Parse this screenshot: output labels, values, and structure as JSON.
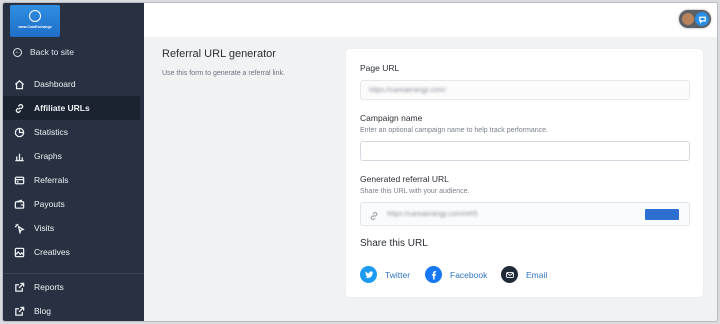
{
  "sidebar": {
    "logo_text": "www.CoinExchange",
    "back_label": "Back to site",
    "items": [
      {
        "label": "Dashboard",
        "icon": "home-icon",
        "active": false
      },
      {
        "label": "Affiliate URLs",
        "icon": "link-icon",
        "active": true
      },
      {
        "label": "Statistics",
        "icon": "pie-chart-icon",
        "active": false
      },
      {
        "label": "Graphs",
        "icon": "bar-chart-icon",
        "active": false
      },
      {
        "label": "Referrals",
        "icon": "card-icon",
        "active": false
      },
      {
        "label": "Payouts",
        "icon": "wallet-icon",
        "active": false
      },
      {
        "label": "Visits",
        "icon": "cursor-icon",
        "active": false
      },
      {
        "label": "Creatives",
        "icon": "image-icon",
        "active": false
      }
    ],
    "secondary": [
      {
        "label": "Reports",
        "icon": "external-link-icon"
      },
      {
        "label": "Blog",
        "icon": "external-link-icon"
      }
    ]
  },
  "header": {
    "toggle_icon": "chat-icon"
  },
  "intro": {
    "title": "Referral URL generator",
    "subtitle": "Use this form to generate a referral link."
  },
  "form": {
    "page_url_label": "Page URL",
    "page_url_value": "https://careaerangji.com/",
    "campaign_label": "Campaign name",
    "campaign_help": "Enter an optional campaign name to help track performance.",
    "campaign_value": "",
    "generated_label": "Generated referral URL",
    "generated_help": "Share this URL with your audience.",
    "generated_value": "https://careaerangji.com/ref/5",
    "share_title": "Share this URL",
    "share": [
      {
        "label": "Twitter",
        "icon": "twitter-icon",
        "color": "#1d9bf0"
      },
      {
        "label": "Facebook",
        "icon": "facebook-icon",
        "color": "#1877f2"
      },
      {
        "label": "Email",
        "icon": "email-icon",
        "color": "#1f2937"
      }
    ]
  },
  "colors": {
    "sidebar_bg": "#273142",
    "accent": "#2d6fd1",
    "link": "#2f74c0"
  }
}
